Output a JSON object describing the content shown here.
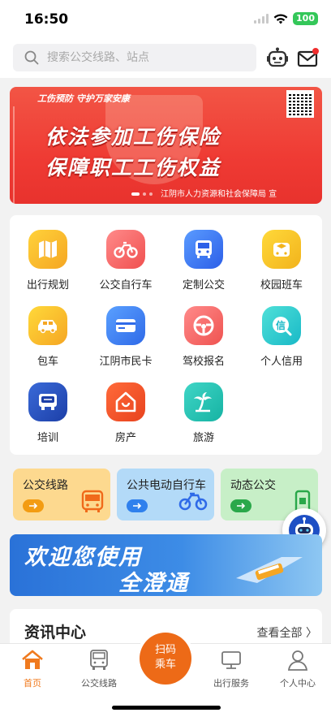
{
  "status": {
    "time": "16:50",
    "battery": "100"
  },
  "search": {
    "placeholder": "搜索公交线路、站点"
  },
  "banner": {
    "tagline": "工伤预防 守护万家安康",
    "line1": "依法参加工伤保险",
    "line2": "保障职工工伤权益",
    "credit": "江阴市人力资源和社会保障局 宣"
  },
  "services": [
    {
      "label": "出行规划",
      "icon": "map-icon"
    },
    {
      "label": "公交自行车",
      "icon": "bicycle-icon"
    },
    {
      "label": "定制公交",
      "icon": "bus-icon"
    },
    {
      "label": "校园班车",
      "icon": "school-bus-icon"
    },
    {
      "label": "包车",
      "icon": "car-icon"
    },
    {
      "label": "江阴市民卡",
      "icon": "card-icon"
    },
    {
      "label": "驾校报名",
      "icon": "steering-wheel-icon"
    },
    {
      "label": "个人信用",
      "icon": "credit-icon"
    },
    {
      "label": "培训",
      "icon": "training-icon"
    },
    {
      "label": "房产",
      "icon": "house-icon"
    },
    {
      "label": "旅游",
      "icon": "palm-tree-icon"
    }
  ],
  "quick": [
    {
      "label": "公交线路",
      "color": "#f39c12"
    },
    {
      "label": "公共电动自行车",
      "color": "#2f80ed"
    },
    {
      "label": "动态公交",
      "color": "#2aa84a"
    }
  ],
  "welcome": {
    "line1": "欢迎您使用",
    "line2": "全澄通"
  },
  "news": {
    "title": "资讯中心",
    "more": "查看全部 〉"
  },
  "tabs": [
    {
      "label": "首页"
    },
    {
      "label": "公交线路"
    },
    {
      "label": "出行服务"
    },
    {
      "label": "个人中心"
    }
  ],
  "scan": {
    "line1": "扫码",
    "line2": "乘车"
  },
  "colors": {
    "accent": "#ed6a17",
    "active_tab": "#f07a1e"
  }
}
